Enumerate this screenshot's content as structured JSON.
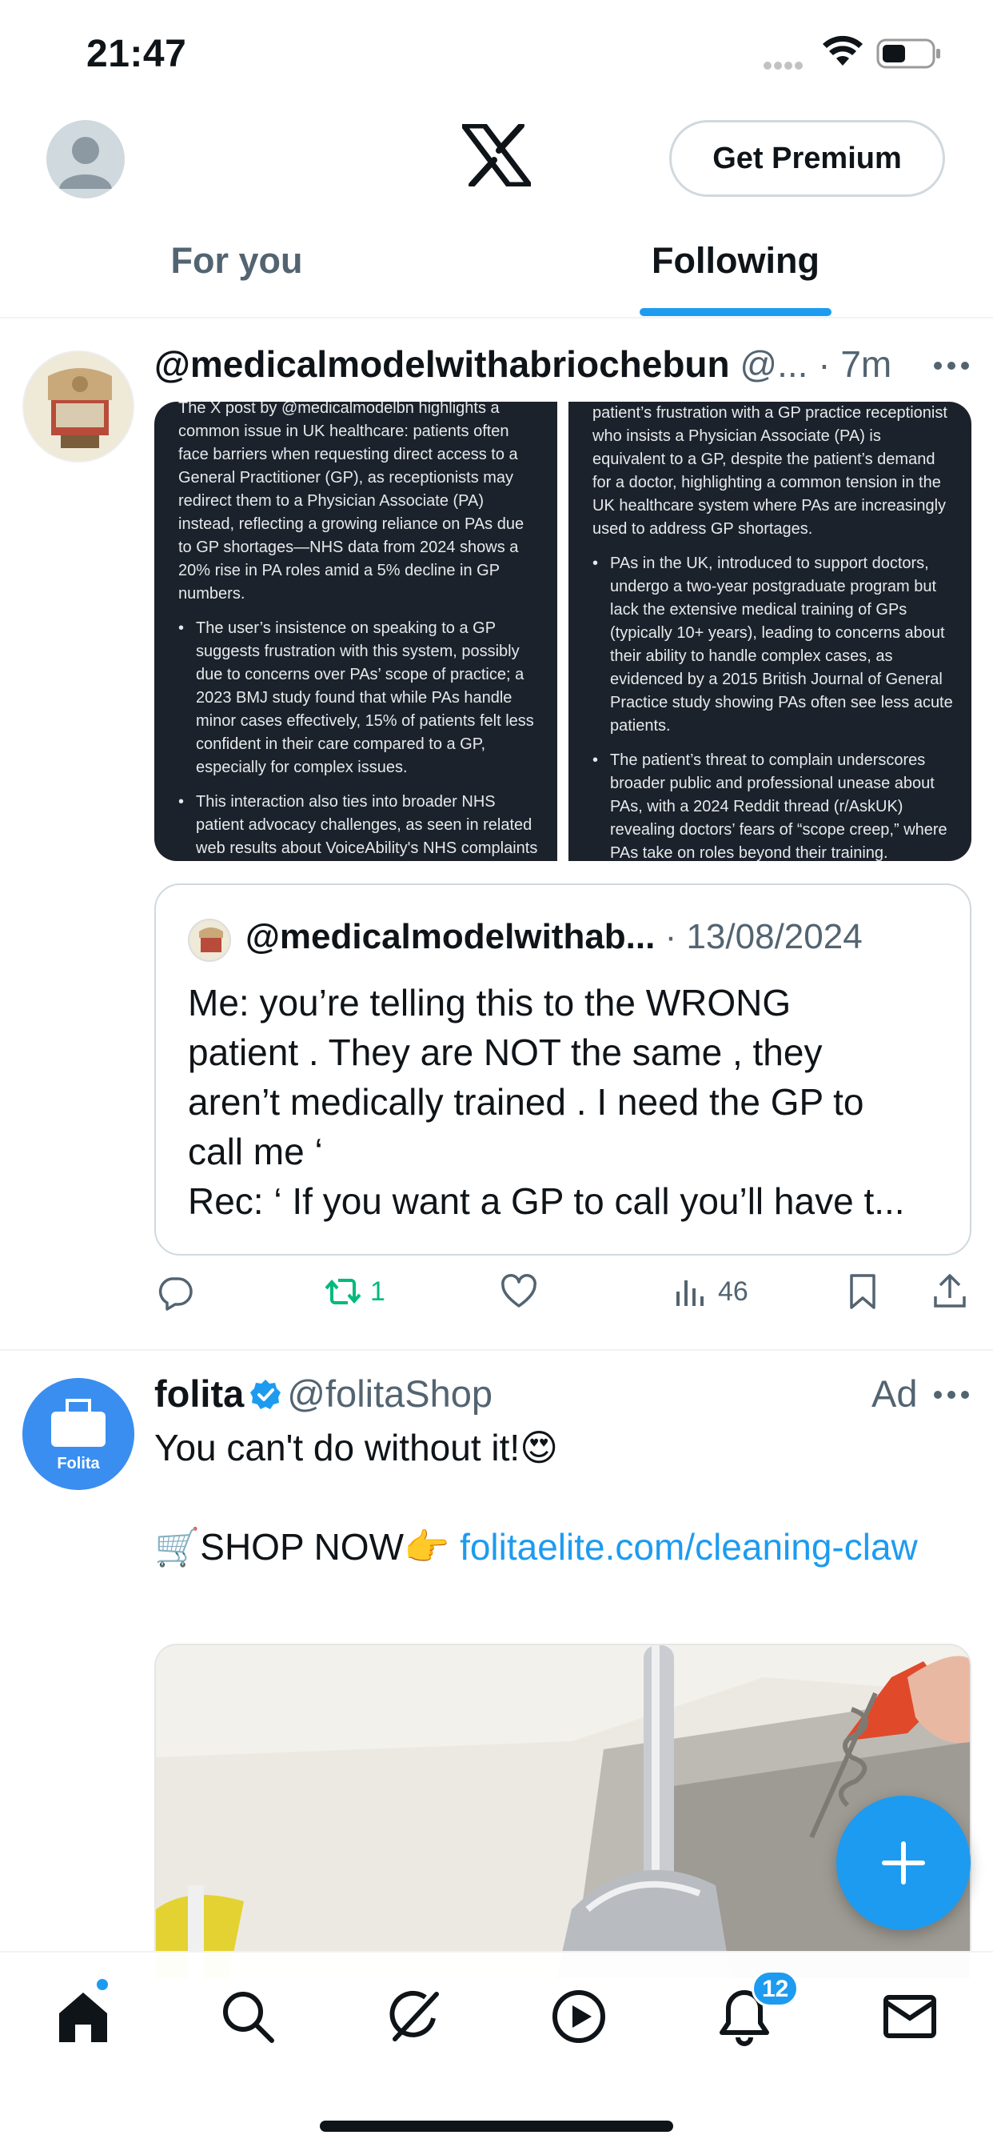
{
  "status_bar": {
    "time": "21:47"
  },
  "header": {
    "premium_label": "Get Premium",
    "tabs": [
      {
        "label": "For you",
        "selected": false
      },
      {
        "label": "Following",
        "selected": true
      }
    ],
    "accent_color": "#1d9bf0"
  },
  "tweet1": {
    "name": "@medicalmodelwithabriochebun",
    "handle": "@...",
    "time": "· 7m",
    "media_left": {
      "intro": "The X post by @medicalmodelbn highlights a common issue in UK healthcare: patients often face barriers when requesting direct access to a General Practitioner (GP), as receptionists may redirect them to a Physician Associate (PA) instead, reflecting a growing reliance on PAs due to GP shortages—NHS data from 2024 shows a 20% rise in PA roles amid a 5% decline in GP numbers.",
      "bullets": [
        "The user’s insistence on speaking to a GP suggests frustration with this system, possibly due to concerns over PAs’ scope of practice; a 2023 BMJ study found that while PAs handle minor cases effectively, 15% of patients felt less confident in their care compared to a GP, especially for complex issues.",
        "This interaction also ties into broader NHS patient advocacy challenges, as seen in related web results about VoiceAbility's NHS complaints"
      ]
    },
    "media_right": {
      "intro": "patient’s frustration with a GP practice receptionist who insists a Physician Associate (PA) is equivalent to a GP, despite the patient’s demand for a doctor, highlighting a common tension in the UK healthcare system where PAs are increasingly used to address GP shortages.",
      "bullets": [
        "PAs in the UK, introduced to support doctors, undergo a two-year postgraduate program but lack the extensive medical training of GPs (typically 10+ years), leading to concerns about their ability to handle complex cases, as evidenced by a 2015 British Journal of General Practice study showing PAs often see less acute patients.",
        "The patient’s threat to complain underscores broader public and professional unease about PAs, with a 2024 Reddit thread (r/AskUK) revealing doctors’ fears of “scope creep,” where PAs take on roles beyond their training."
      ]
    },
    "quote": {
      "name": "@medicalmodelwithab...",
      "date": "· 13/08/2024",
      "lines": [
        "Me: you’re telling this to the WRONG",
        "patient . They are NOT the same , they",
        "aren’t medically trained  . I need the GP to",
        "call me ‘",
        "Rec: ‘ If you want a GP to call you’ll have t..."
      ]
    },
    "stats": {
      "replies": "",
      "reposts": "1",
      "likes": "",
      "views": "46"
    },
    "repost_color": "#00ba7c"
  },
  "tweet2": {
    "name": "folita",
    "handle": "@folitaShop",
    "ad_label": "Ad",
    "avatar_text": "Folita",
    "text_line1": "You can't do without it!😍",
    "shop_prefix": "🛒SHOP NOW👉 ",
    "link": "folitaelite.com/cleaning-claw"
  },
  "bottom_nav": {
    "items": [
      "home-icon",
      "search-icon",
      "grok-icon",
      "video-icon",
      "bell-icon",
      "mail-icon"
    ],
    "notifications_badge": "12"
  }
}
